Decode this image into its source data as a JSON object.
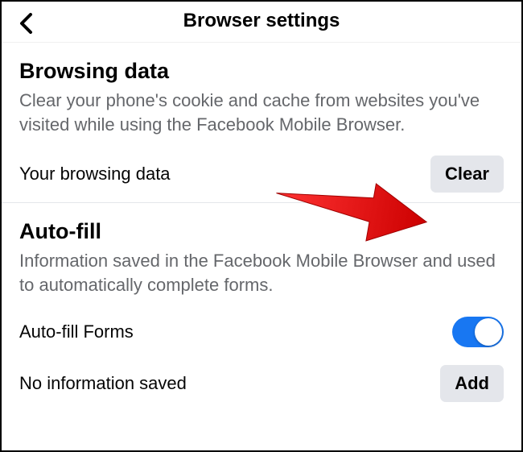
{
  "header": {
    "title": "Browser settings"
  },
  "browsing_data": {
    "title": "Browsing data",
    "description": "Clear your phone's cookie and cache from websites you've visited while using the Facebook Mobile Browser.",
    "row_label": "Your browsing data",
    "clear_button": "Clear"
  },
  "autofill": {
    "title": "Auto-fill",
    "description": "Information saved in the Facebook Mobile Browser and used to automatically complete forms.",
    "forms_label": "Auto-fill Forms",
    "forms_toggle_on": true,
    "no_info_label": "No information saved",
    "add_button": "Add"
  },
  "annotation": {
    "arrow_color": "#ff0000"
  }
}
